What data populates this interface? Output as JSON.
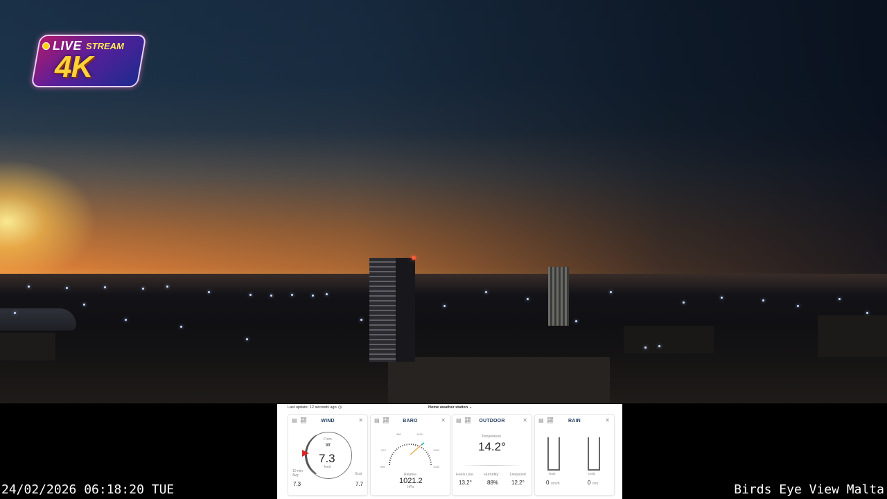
{
  "stream_badge": {
    "live": "LIVE",
    "stream": "STREAM",
    "resolution": "4K"
  },
  "overlay": {
    "timestamp": "24/02/2026 06:18:20 TUE",
    "channel_name": "Birds Eye View Malta"
  },
  "weather_panel": {
    "last_update": "Last update: 12 seconds ago",
    "station_selector": "Home weather station",
    "cards": {
      "wind": {
        "title": "WIND",
        "from_label": "From",
        "direction": "W",
        "speed": "7.3",
        "unit": "knot",
        "avg_label": "10 min Avg",
        "avg_value": "7.3",
        "gust_label": "Gust",
        "gust_value": "7.7",
        "direction_degrees": 270
      },
      "baro": {
        "title": "BARO",
        "relative_label": "Relative",
        "value": "1021.2",
        "unit": "hPa",
        "scale_ticks": [
          "970",
          "980",
          "990",
          "1000",
          "1010",
          "1020",
          "1030"
        ]
      },
      "outdoor": {
        "title": "OUTDOOR",
        "temperature_label": "Temperature",
        "temperature": "14.2°",
        "feels_like_label": "Feels Like",
        "feels_like": "13.2°",
        "humidity_label": "Humidity",
        "humidity": "88%",
        "dewpoint_label": "Dewpoint",
        "dewpoint": "12.2°"
      },
      "rain": {
        "title": "RAIN",
        "rate_label": "Rate",
        "rate_value": "0",
        "rate_unit": "mm/h",
        "daily_label": "Daily",
        "daily_value": "0",
        "daily_unit": "mm"
      }
    }
  }
}
